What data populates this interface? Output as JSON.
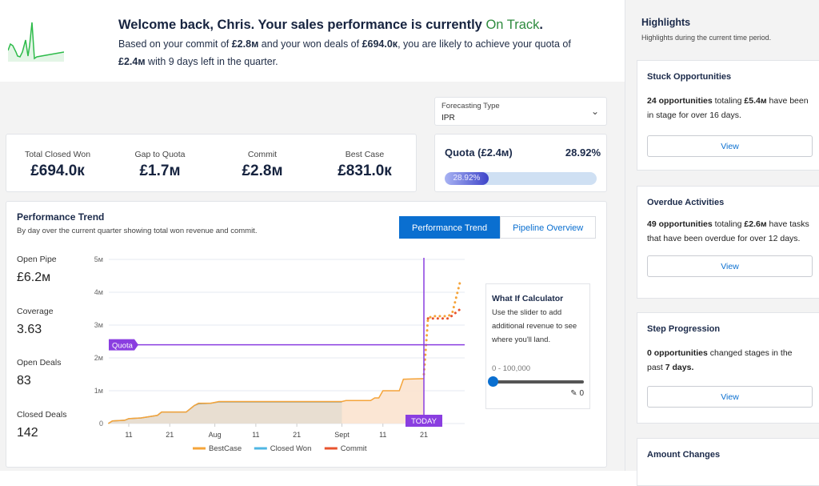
{
  "header": {
    "welcome_prefix": "Welcome back, Chris. Your sales performance is currently ",
    "status": "On Track",
    "status_color": "#2e8b3e",
    "summary": [
      "Based on your commit of ",
      "£2.8м",
      " and your won deals of ",
      "£694.0к",
      ", you are likely to achieve your quota of ",
      "£2.4м",
      " with 9 days left in the quarter."
    ]
  },
  "forecasting": {
    "label": "Forecasting Type",
    "value": "IPR"
  },
  "kpis": [
    {
      "label": "Total Closed Won",
      "value": "£694.0к"
    },
    {
      "label": "Gap to Quota",
      "value": "£1.7м"
    },
    {
      "label": "Commit",
      "value": "£2.8м"
    },
    {
      "label": "Best Case",
      "value": "£831.0к"
    }
  ],
  "quota": {
    "label": "Quota (£2.4м)",
    "percent_text": "28.92%",
    "percent": 28.92
  },
  "performance": {
    "title": "Performance Trend",
    "description": "By day over the current quarter showing total won revenue and commit.",
    "tabs": [
      "Performance Trend",
      "Pipeline Overview"
    ],
    "stats": [
      {
        "label": "Open Pipe",
        "value": "£6.2м"
      },
      {
        "label": "Coverage",
        "value": "3.63"
      },
      {
        "label": "Open Deals",
        "value": "83"
      },
      {
        "label": "Closed Deals",
        "value": "142"
      }
    ],
    "what_if": {
      "title": "What If Calculator",
      "description": "Use the slider to add additional revenue to see where you'll land.",
      "range": "0 - 100,000",
      "value": "0",
      "slider_fraction": 0
    }
  },
  "chart_data": {
    "type": "line",
    "ylim": [
      0,
      5
    ],
    "yticks": [
      "0",
      "1м",
      "2м",
      "3м",
      "4м",
      "5м"
    ],
    "ytick_values": [
      0,
      1,
      2,
      3,
      4,
      5
    ],
    "xticks": [
      {
        "label": "11",
        "date": "Jul 11"
      },
      {
        "label": "21",
        "date": "Jul 21"
      },
      {
        "label": "Aug",
        "date": "Aug 1"
      },
      {
        "label": "11",
        "date": "Aug 11"
      },
      {
        "label": "21",
        "date": "Aug 21"
      },
      {
        "label": "Sept",
        "date": "Sep 1"
      },
      {
        "label": "11",
        "date": "Sep 11"
      },
      {
        "label": "21",
        "date": "Sep 21"
      }
    ],
    "xlim": [
      "Jul 6",
      "Sep 30"
    ],
    "quota_line": {
      "label": "Quota",
      "value": 2.4
    },
    "today": {
      "label": "TODAY",
      "date": "Sep 21"
    },
    "series": [
      {
        "name": "BestCase",
        "color": "#f5a43a",
        "points": [
          [
            "Jul 6",
            0
          ],
          [
            "Jul 7",
            0.08
          ],
          [
            "Jul 10",
            0.1
          ],
          [
            "Jul 11",
            0.15
          ],
          [
            "Jul 14",
            0.17
          ],
          [
            "Jul 18",
            0.25
          ],
          [
            "Jul 19",
            0.35
          ],
          [
            "Jul 25",
            0.35
          ],
          [
            "Jul 27",
            0.55
          ],
          [
            "Jul 28",
            0.62
          ],
          [
            "Jul 31",
            0.62
          ],
          [
            "Aug 2",
            0.67
          ],
          [
            "Sep 1",
            0.67
          ],
          [
            "Sep 2",
            0.7
          ],
          [
            "Sep 8",
            0.7
          ],
          [
            "Sep 9",
            0.78
          ],
          [
            "Sep 10",
            0.78
          ],
          [
            "Sep 11",
            1.0
          ],
          [
            "Sep 15",
            1.0
          ],
          [
            "Sep 16",
            1.35
          ],
          [
            "Sep 21",
            1.37
          ]
        ],
        "projected": [
          [
            "Sep 21",
            1.5
          ],
          [
            "Sep 22",
            3.2
          ],
          [
            "Sep 23",
            3.27
          ],
          [
            "Sep 27",
            3.27
          ],
          [
            "Sep 28",
            3.4
          ],
          [
            "Sep 29",
            3.9
          ],
          [
            "Sep 30",
            4.4
          ]
        ]
      },
      {
        "name": "Closed Won",
        "color": "#4fb6e3",
        "points": [
          [
            "Jul 6",
            0
          ],
          [
            "Jul 7",
            0.08
          ],
          [
            "Jul 10",
            0.1
          ],
          [
            "Jul 11",
            0.15
          ],
          [
            "Jul 14",
            0.17
          ],
          [
            "Jul 18",
            0.25
          ],
          [
            "Jul 19",
            0.35
          ],
          [
            "Jul 25",
            0.35
          ],
          [
            "Jul 27",
            0.55
          ],
          [
            "Jul 28",
            0.6
          ],
          [
            "Jul 31",
            0.62
          ],
          [
            "Aug 2",
            0.66
          ],
          [
            "Sep 1",
            0.66
          ]
        ]
      },
      {
        "name": "Commit",
        "color": "#e8532e",
        "projected": [
          [
            "Sep 22",
            3.2
          ],
          [
            "Sep 24",
            3.2
          ],
          [
            "Sep 27",
            3.2
          ],
          [
            "Sep 28",
            3.3
          ],
          [
            "Sep 29",
            3.4
          ],
          [
            "Sep 30",
            3.5
          ]
        ]
      }
    ]
  },
  "highlights": {
    "title": "Highlights",
    "subtitle": "Highlights during the current time period.",
    "cards": [
      {
        "title": "Stuck Opportunities",
        "bold": "24 opportunities",
        "text": " totaling ",
        "bold2": "£5.4м",
        "text2": " have been in stage for over 16 days.",
        "button": "View"
      },
      {
        "title": "Overdue Activities",
        "bold": "49 opportunities",
        "text": " totaling ",
        "bold2": "£2.6м",
        "text2": " have tasks that have been overdue for over 12 days.",
        "button": "View"
      },
      {
        "title": "Step Progression",
        "bold": "0 opportunities",
        "text": " changed stages in the past ",
        "bold2": "7 days.",
        "text2": "",
        "button": "View"
      },
      {
        "title": "Amount Changes"
      }
    ]
  }
}
